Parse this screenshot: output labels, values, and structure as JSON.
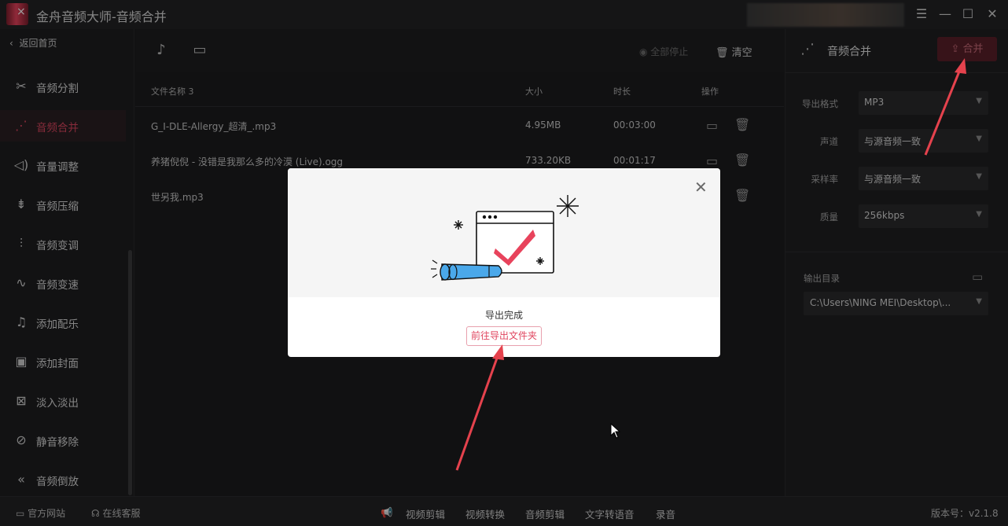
{
  "window": {
    "title": "金舟音频大师-音频合并",
    "controls": [
      "menu-icon",
      "minimize-icon",
      "maximize-icon",
      "close-icon"
    ]
  },
  "sidebar": {
    "back_label": "返回首页",
    "items": [
      {
        "label": "音频分割",
        "icon": "scissors-icon"
      },
      {
        "label": "音频合并",
        "icon": "merge-icon",
        "active": true
      },
      {
        "label": "音量调整",
        "icon": "volume-icon"
      },
      {
        "label": "音频压缩",
        "icon": "compress-icon"
      },
      {
        "label": "音频变调",
        "icon": "equalizer-icon"
      },
      {
        "label": "音频变速",
        "icon": "wave-icon"
      },
      {
        "label": "添加配乐",
        "icon": "music-note-icon"
      },
      {
        "label": "添加封面",
        "icon": "image-icon"
      },
      {
        "label": "淡入淡出",
        "icon": "fade-icon"
      },
      {
        "label": "静音移除",
        "icon": "mute-icon"
      },
      {
        "label": "音频倒放",
        "icon": "rewind-icon"
      }
    ]
  },
  "toolbar": {
    "stop_all": "全部停止",
    "clear": "清空"
  },
  "table": {
    "headers": {
      "name": "文件名称 3",
      "size": "大小",
      "duration": "时长",
      "actions": "操作"
    },
    "rows": [
      {
        "name": "G_I-DLE-Allergy_超清_.mp3",
        "size": "4.95MB",
        "duration": "00:03:00"
      },
      {
        "name": "养猪倪倪 - 没错是我那么多的冷漠 (Live).ogg",
        "size": "733.20KB",
        "duration": "00:01:17"
      },
      {
        "name": "世另我.mp3",
        "size": "",
        "duration": ""
      }
    ]
  },
  "right_panel": {
    "title": "音频合并",
    "merge_button": "合并",
    "settings": [
      {
        "label": "导出格式",
        "value": "MP3"
      },
      {
        "label": "声道",
        "value": "与源音频一致"
      },
      {
        "label": "采样率",
        "value": "与源音频一致"
      },
      {
        "label": "质量",
        "value": "256kbps"
      }
    ],
    "output_label": "输出目录",
    "output_path": "C:\\Users\\NING MEI\\Desktop\\..."
  },
  "bottom_bar": {
    "left": [
      "官方网站",
      "在线客服"
    ],
    "center": [
      "视频剪辑",
      "视频转换",
      "音频剪辑",
      "文字转语音",
      "录音"
    ],
    "version": "版本号：v2.1.8"
  },
  "modal": {
    "message": "导出完成",
    "open_folder_button": "前往导出文件夹"
  },
  "colors": {
    "accent": "#e0465f",
    "arrow": "#e5424d",
    "background": "#1c1c1e"
  }
}
